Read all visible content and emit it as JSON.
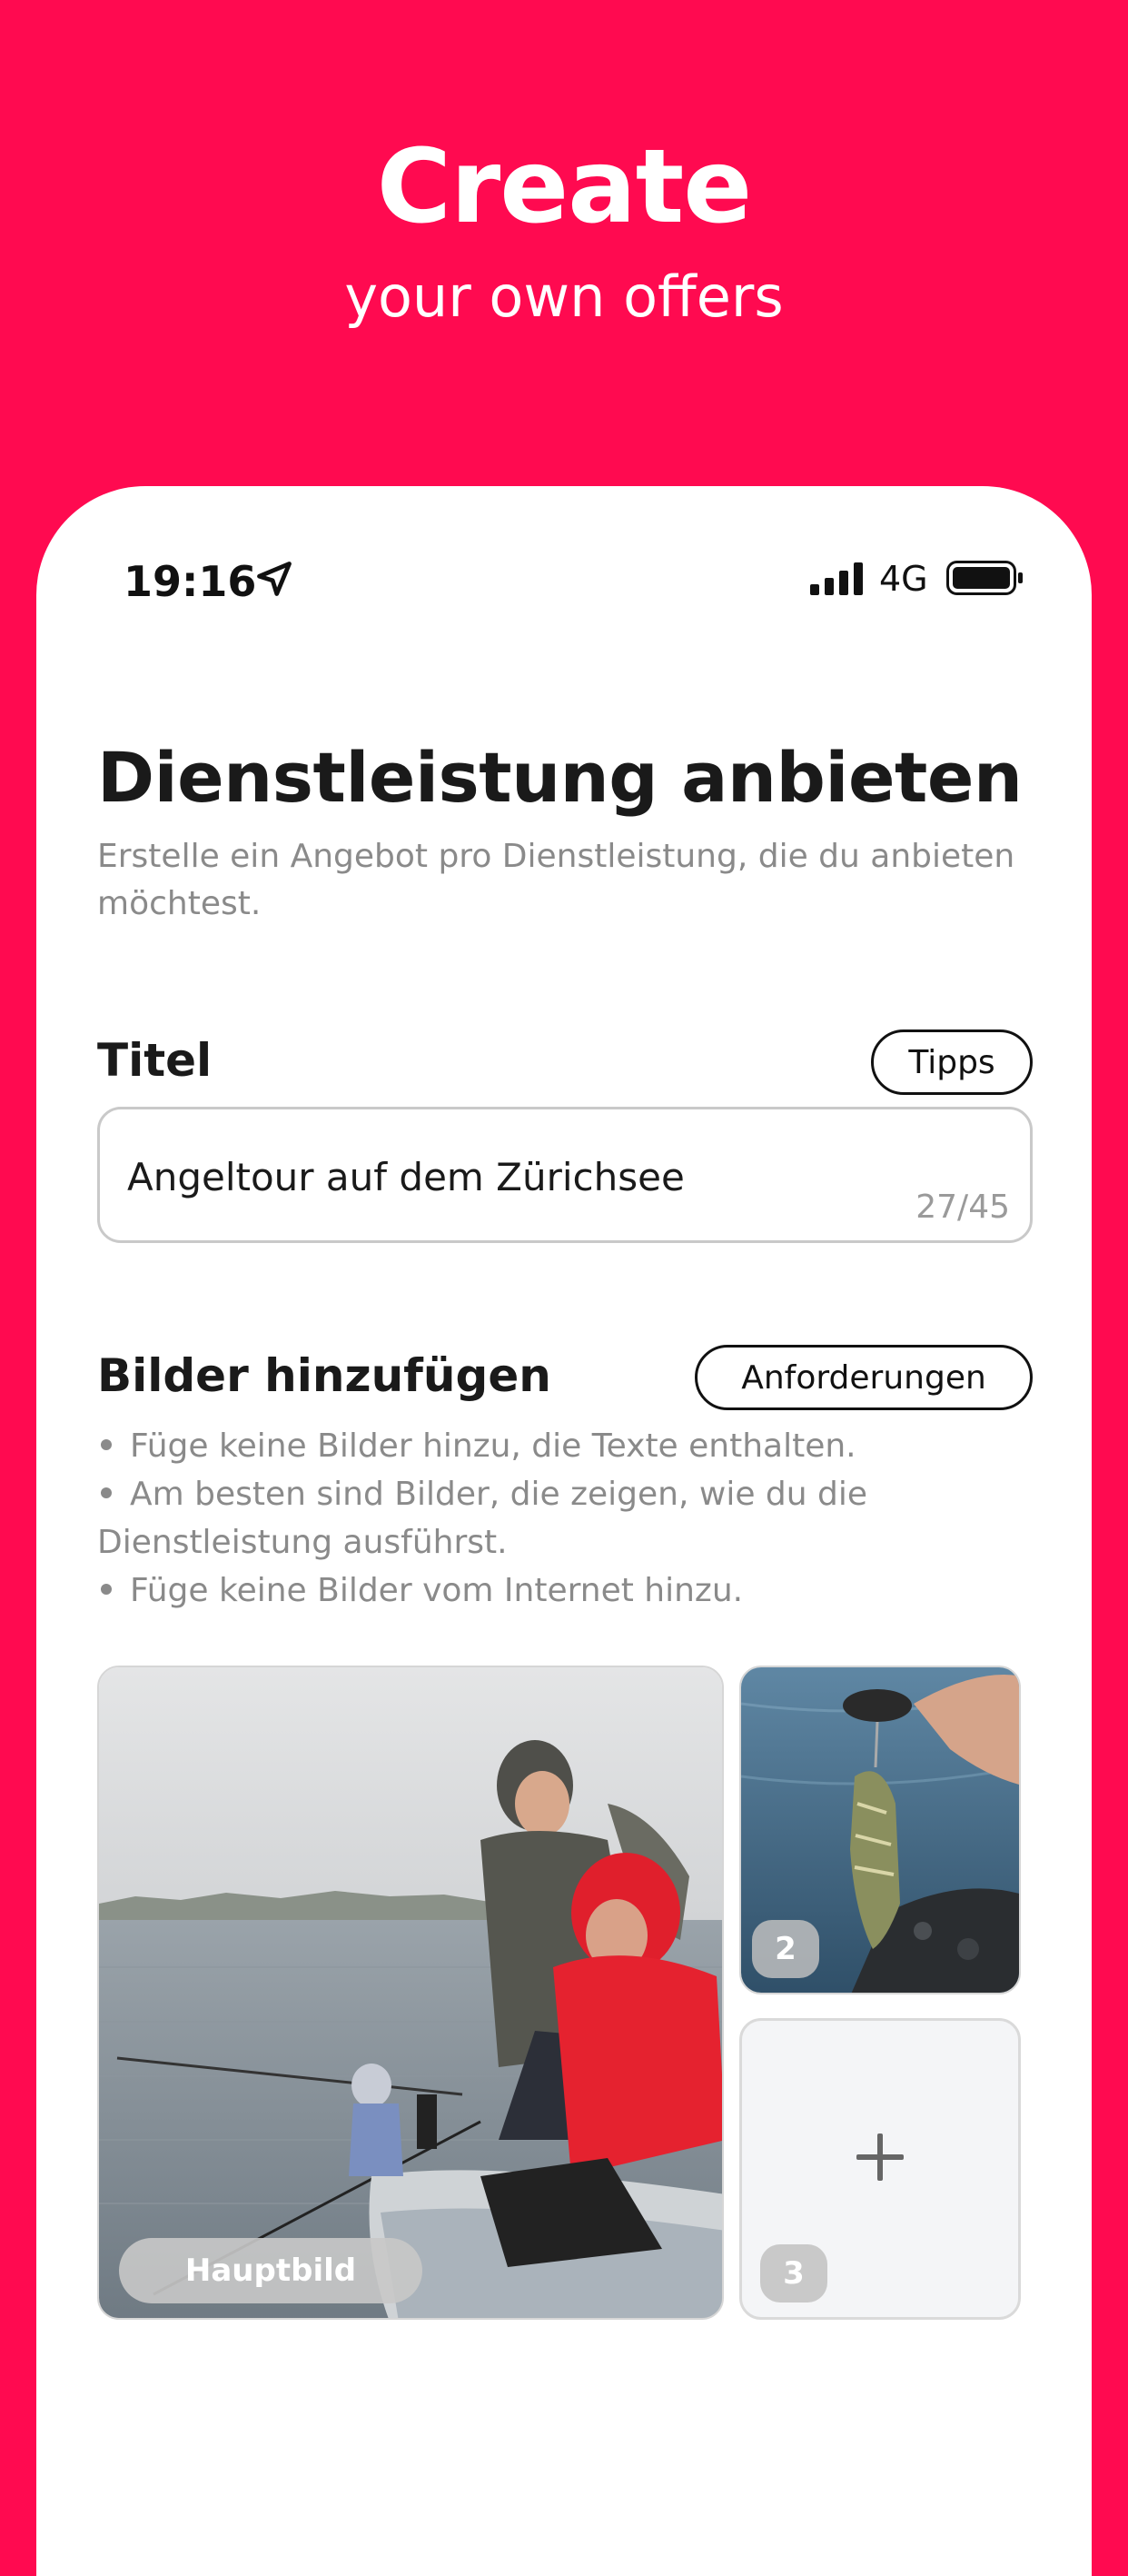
{
  "hero": {
    "title": "Create",
    "subtitle": "your own offers"
  },
  "status_bar": {
    "time": "19:16",
    "network": "4G"
  },
  "page": {
    "title": "Dienstleistung anbieten",
    "subtitle": "Erstelle ein Angebot pro Dienstleistung, die du anbieten möchtest."
  },
  "title_section": {
    "label": "Titel",
    "tips_button": "Tipps",
    "input_value": "Angeltour auf dem Zürichsee",
    "counter": "27/45"
  },
  "images_section": {
    "label": "Bilder hinzufügen",
    "requirements_button": "Anforderungen",
    "bullets": [
      "Füge keine Bilder hinzu, die Texte enthalten.",
      "Am besten sind Bilder, die zeigen, wie du die Dienstleistung ausführst.",
      "Füge keine Bilder vom Internet hinzu."
    ],
    "main_image_label": "Hauptbild",
    "slot_2_badge": "2",
    "slot_3_badge": "3"
  },
  "colors": {
    "brand": "#ff0a50",
    "text": "#1a1a1a",
    "muted": "#8a8a8a"
  }
}
